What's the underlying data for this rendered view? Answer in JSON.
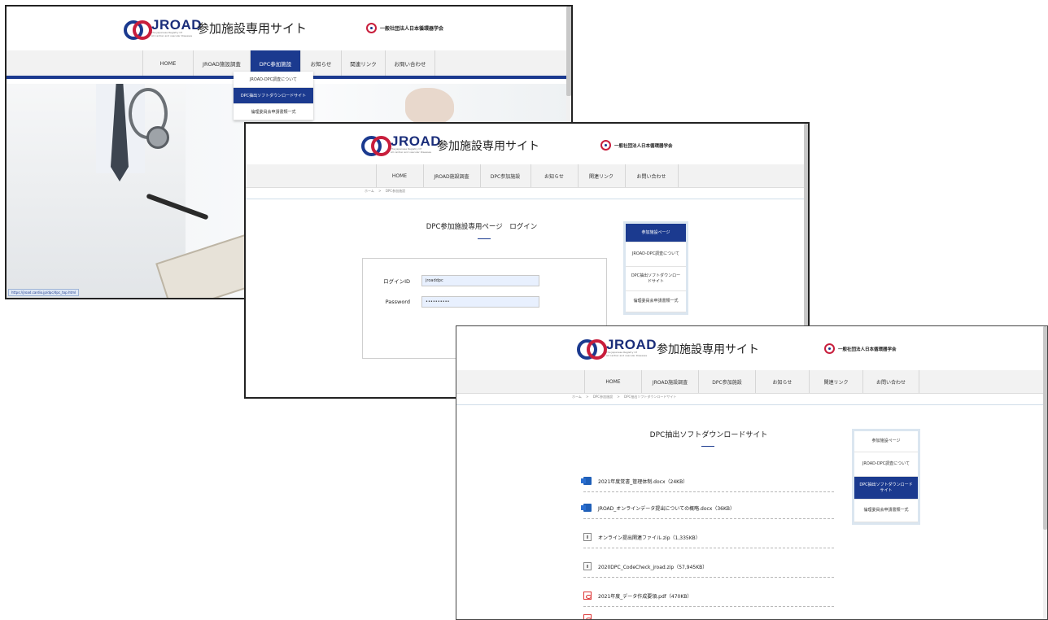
{
  "header": {
    "logo_name": "JROAD",
    "logo_sub1": "The Japanese Registry Of",
    "logo_sub2": "All cardiac and vascular Diseases",
    "site_title": "参加施設専用サイト",
    "org_name": "一般社団法人日本循環器学会"
  },
  "nav": {
    "home": "HOME",
    "survey": "JROAD施設調査",
    "dpc": "DPC参加施設",
    "news": "お知らせ",
    "links": "関連リンク",
    "contact": "お問い合わせ"
  },
  "shot1": {
    "dropdown": [
      "JROAD-DPC調査について",
      "DPC抽出ソフトダウンロードサイト",
      "倫理委員会申請書類一式"
    ],
    "status_url": "https://jroad.cardio.jp/dpc/dpc_top.html"
  },
  "shot2": {
    "breadcrumb": [
      "ホーム",
      ">",
      "DPC参加施設"
    ],
    "heading": "DPC参加施設専用ページ　ログイン",
    "login_id_label": "ログインID",
    "login_id_value": "jroaddpc",
    "password_label": "Password",
    "password_value": "••••••••••",
    "sidebar": [
      "参加施設ページ",
      "JROAD-DPC調査について",
      "DPC抽出ソフトダウンロードサイト",
      "倫理委員会申請書類一式"
    ]
  },
  "shot3": {
    "breadcrumb": [
      "ホーム",
      ">",
      "DPC参加施設",
      ">",
      "DPC抽出ソフトダウンロードサイト"
    ],
    "heading": "DPC抽出ソフトダウンロードサイト",
    "files": [
      {
        "name": "2021年度覚書_管理体制.docx（24KB）",
        "icon": "word-icon"
      },
      {
        "name": "JROAD_オンラインデータ提出についての概略.docx（36KB）",
        "icon": "word-icon"
      },
      {
        "name": "オンライン提出関連ファイル.zip（1,335KB）",
        "icon": "zip-icon"
      },
      {
        "name": "2020DPC_CodeCheck_jroad.zip（57,945KB）",
        "icon": "zip-icon"
      },
      {
        "name": "2021年度_データ作成要領.pdf（470KB）",
        "icon": "pdf-icon"
      }
    ],
    "sidebar": [
      "参加施設ページ",
      "JROAD-DPC調査について",
      "DPC抽出ソフトダウンロードサイト",
      "倫理委員会申請書類一式"
    ]
  },
  "colors": {
    "brand_blue": "#1b3a8f",
    "nav_bg": "#f2f2f2",
    "sidebar_bg": "#dbe6f0",
    "logo_red": "#c81e3c"
  }
}
